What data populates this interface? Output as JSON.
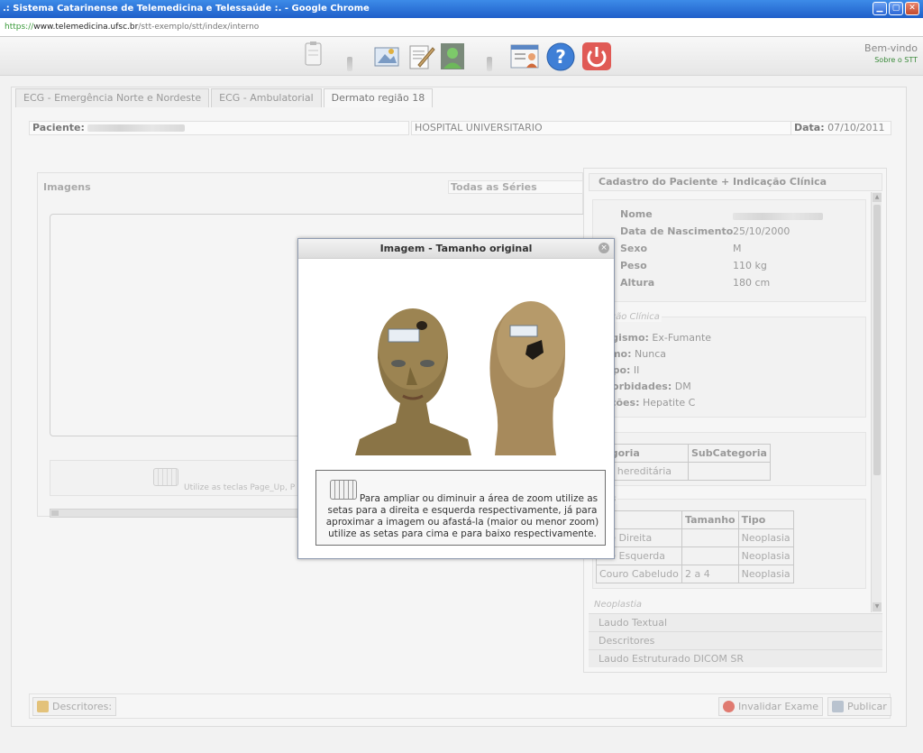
{
  "window": {
    "title": ".: Sistema Catarinense de Telemedicina e Telessaúde :. - Google Chrome",
    "url_scheme": "https://",
    "url_host": "www.telemedicina.ufsc.br",
    "url_path": "/stt-exemplo/stt/index/interno"
  },
  "header": {
    "welcome": "Bem-vindo",
    "about": "Sobre o STT"
  },
  "tabs": [
    {
      "label": "ECG - Emergência Norte e Nordeste"
    },
    {
      "label": "ECG - Ambulatorial"
    },
    {
      "label": "Dermato região 18"
    }
  ],
  "patient_bar": {
    "patient_label": "Paciente:",
    "hospital": "HOSPITAL UNIVERSITARIO",
    "date_label": "Data:",
    "date": "07/10/2011"
  },
  "images_panel": {
    "title": "Imagens",
    "series_select": "Todas as Séries",
    "hint": "Utilize as teclas Page_Up, P"
  },
  "right_panel": {
    "title": "Cadastro do Paciente + Indicação Clínica",
    "patient": {
      "name_label": "Nome",
      "birth_label": "Data de Nascimento",
      "birth": "25/10/2000",
      "sex_label": "Sexo",
      "sex": "M",
      "weight_label": "Peso",
      "weight": "110 kg",
      "height_label": "Altura",
      "height": "180 cm"
    },
    "clinical": {
      "legend": "cação Clínica",
      "smoking_label": "bagismo:",
      "smoking": "Ex-Fumante",
      "alcohol_label": "lismo:",
      "alcohol": "Nunca",
      "phototype_label": "otipo:",
      "phototype": "II",
      "comorbidities_label": "-morbidades:",
      "comorbidities": "DM",
      "infections_label": "ecções:",
      "infections": "Hepatite C"
    },
    "category_section": {
      "legend": "o",
      "headers": [
        "tegoria",
        "SubCategoria"
      ],
      "rows": [
        [
          "xia hereditária",
          ""
        ]
      ]
    },
    "lesions_section": {
      "legend": "ões",
      "headers": [
        "cal",
        "Tamanho",
        "Tipo"
      ],
      "rows": [
        [
          "nte Direita",
          "",
          "Neoplasia"
        ],
        [
          "nte Esquerda",
          "",
          "Neoplasia"
        ],
        [
          "Couro Cabeludo",
          "2 a 4",
          "Neoplasia"
        ]
      ]
    },
    "neoplasia_legend": "Neoplastia",
    "accordion": [
      {
        "label": "Laudo Textual"
      },
      {
        "label": "Descritores"
      },
      {
        "label": "Laudo Estruturado DICOM SR"
      }
    ]
  },
  "bottom_bar": {
    "descriptors": "Descritores:",
    "invalidate": "Invalidar Exame",
    "publish": "Publicar"
  },
  "modal": {
    "title": "Imagem - Tamanho original",
    "close": "×",
    "instructions": "Para ampliar ou diminuir a área de zoom utilize as setas para a direita e esquerda respectivamente, já para aproximar a imagem ou afastá-la (maior ou menor zoom) utilize as setas para cima e para baixo respectivamente."
  },
  "colors": {
    "titlebar": "#2a6fd8",
    "power_button": "#e05a55",
    "help_button": "#3f7fd6"
  }
}
